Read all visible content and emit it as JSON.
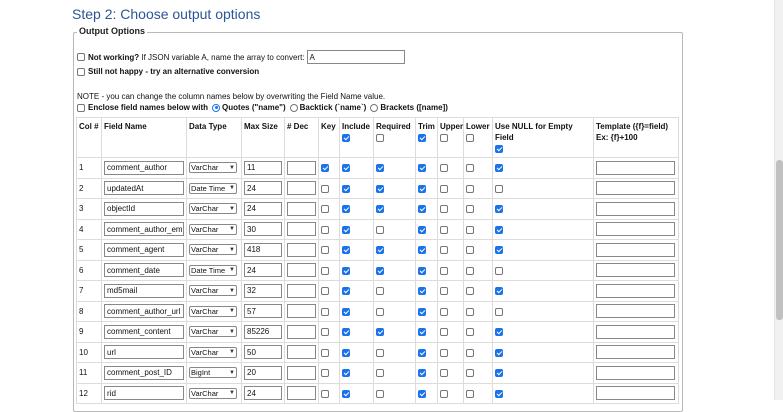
{
  "page_title": "Step 2: Choose output options",
  "legend": "Output Options",
  "not_working": {
    "label": "Not working?",
    "text": "If JSON variable A, name the array to convert:",
    "value": "A",
    "checked": false
  },
  "still_not_happy": {
    "label": "Still not happy - try an alternative conversion",
    "checked": false
  },
  "note": "NOTE - you can change the column names below by overwriting the Field Name value.",
  "enclose": {
    "label": "Enclose field names below with",
    "checked": false,
    "options": [
      {
        "label": "Quotes (\"name\")",
        "selected": true
      },
      {
        "label": "Backtick (`name`)",
        "selected": false
      },
      {
        "label": "Brackets ([name])",
        "selected": false
      }
    ]
  },
  "table": {
    "headers": {
      "col": "Col #",
      "field": "Field Name",
      "type": "Data Type",
      "max": "Max Size",
      "dec": "# Dec",
      "key": "Key",
      "include": "Include",
      "required": "Required",
      "trim": "Trim",
      "upper": "Upper",
      "lower": "Lower",
      "null": "Use NULL for Empty Field",
      "template": "Template ({f}=field) Ex: {f}+100"
    },
    "header_checks": {
      "include": true,
      "required": false,
      "trim": true,
      "upper": false,
      "lower": false,
      "null": true
    },
    "rows": [
      {
        "num": "1",
        "field": "comment_author",
        "type": "VarChar",
        "max": "11",
        "key": true,
        "include": true,
        "required": true,
        "trim": true,
        "upper": false,
        "lower": false,
        "null": true
      },
      {
        "num": "2",
        "field": "updatedAt",
        "type": "Date Time",
        "max": "24",
        "key": false,
        "include": true,
        "required": true,
        "trim": true,
        "upper": false,
        "lower": false,
        "null": false
      },
      {
        "num": "3",
        "field": "objectId",
        "type": "VarChar",
        "max": "24",
        "key": false,
        "include": true,
        "required": true,
        "trim": true,
        "upper": false,
        "lower": false,
        "null": true
      },
      {
        "num": "4",
        "field": "comment_author_ema",
        "type": "VarChar",
        "max": "30",
        "key": false,
        "include": true,
        "required": false,
        "trim": true,
        "upper": false,
        "lower": false,
        "null": true
      },
      {
        "num": "5",
        "field": "comment_agent",
        "type": "VarChar",
        "max": "418",
        "key": false,
        "include": true,
        "required": true,
        "trim": true,
        "upper": false,
        "lower": false,
        "null": true
      },
      {
        "num": "6",
        "field": "comment_date",
        "type": "Date Time",
        "max": "24",
        "key": false,
        "include": true,
        "required": true,
        "trim": true,
        "upper": false,
        "lower": false,
        "null": false
      },
      {
        "num": "7",
        "field": "md5mail",
        "type": "VarChar",
        "max": "32",
        "key": false,
        "include": true,
        "required": false,
        "trim": true,
        "upper": false,
        "lower": false,
        "null": true
      },
      {
        "num": "8",
        "field": "comment_author_url",
        "type": "VarChar",
        "max": "57",
        "key": false,
        "include": true,
        "required": false,
        "trim": true,
        "upper": false,
        "lower": false,
        "null": false
      },
      {
        "num": "9",
        "field": "comment_content",
        "type": "VarChar",
        "max": "85226",
        "key": false,
        "include": true,
        "required": true,
        "trim": true,
        "upper": false,
        "lower": false,
        "null": true
      },
      {
        "num": "10",
        "field": "url",
        "type": "VarChar",
        "max": "50",
        "key": false,
        "include": true,
        "required": false,
        "trim": true,
        "upper": false,
        "lower": false,
        "null": true
      },
      {
        "num": "11",
        "field": "comment_post_ID",
        "type": "BigInt",
        "max": "20",
        "key": false,
        "include": true,
        "required": false,
        "trim": true,
        "upper": false,
        "lower": false,
        "null": true
      },
      {
        "num": "12",
        "field": "rid",
        "type": "VarChar",
        "max": "24",
        "key": false,
        "include": true,
        "required": false,
        "trim": true,
        "upper": false,
        "lower": false,
        "null": true
      }
    ]
  }
}
